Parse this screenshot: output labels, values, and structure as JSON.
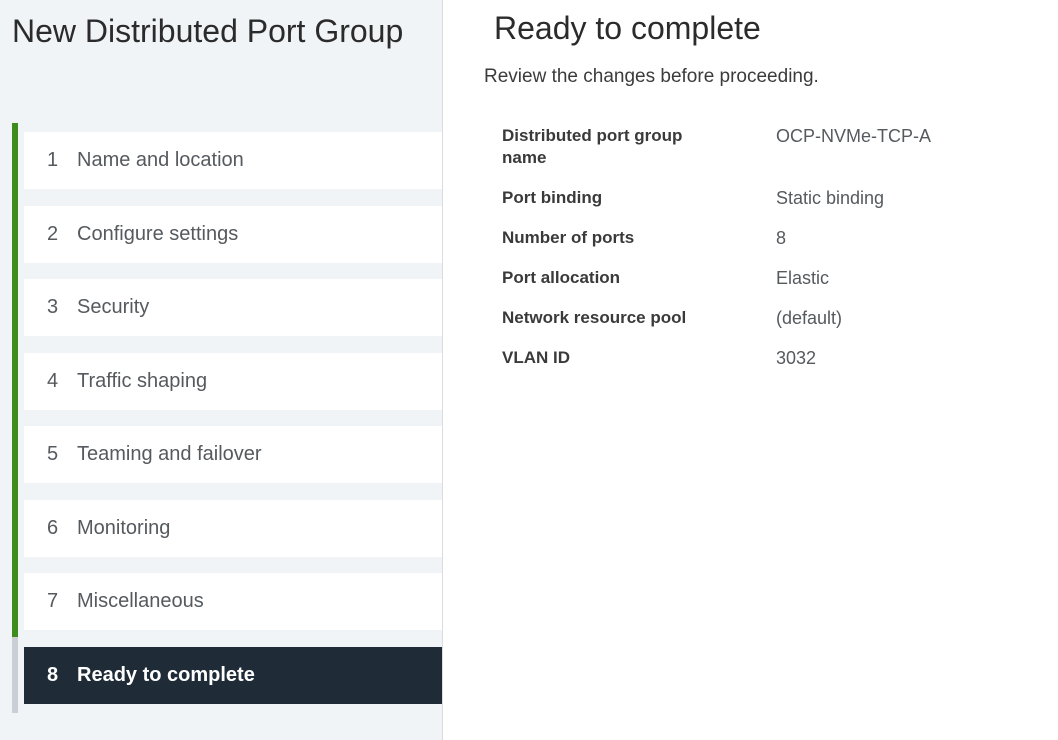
{
  "wizard": {
    "title": "New Distributed Port Group"
  },
  "steps": [
    {
      "num": "1",
      "label": "Name and location"
    },
    {
      "num": "2",
      "label": "Configure settings"
    },
    {
      "num": "3",
      "label": "Security"
    },
    {
      "num": "4",
      "label": "Traffic shaping"
    },
    {
      "num": "5",
      "label": "Teaming and failover"
    },
    {
      "num": "6",
      "label": "Monitoring"
    },
    {
      "num": "7",
      "label": "Miscellaneous"
    },
    {
      "num": "8",
      "label": "Ready to complete"
    }
  ],
  "main": {
    "title": "Ready to complete",
    "subtitle": "Review the changes before proceeding.",
    "summary": [
      {
        "label": "Distributed port group name",
        "value": "OCP-NVMe-TCP-A"
      },
      {
        "label": "Port binding",
        "value": "Static binding"
      },
      {
        "label": "Number of ports",
        "value": "8"
      },
      {
        "label": "Port allocation",
        "value": "Elastic"
      },
      {
        "label": "Network resource pool",
        "value": "(default)"
      },
      {
        "label": "VLAN ID",
        "value": "3032"
      }
    ]
  },
  "colors": {
    "progress": "#3f8c1e",
    "active_step": "#1f2c37",
    "sidebar_bg": "#f0f4f7"
  }
}
